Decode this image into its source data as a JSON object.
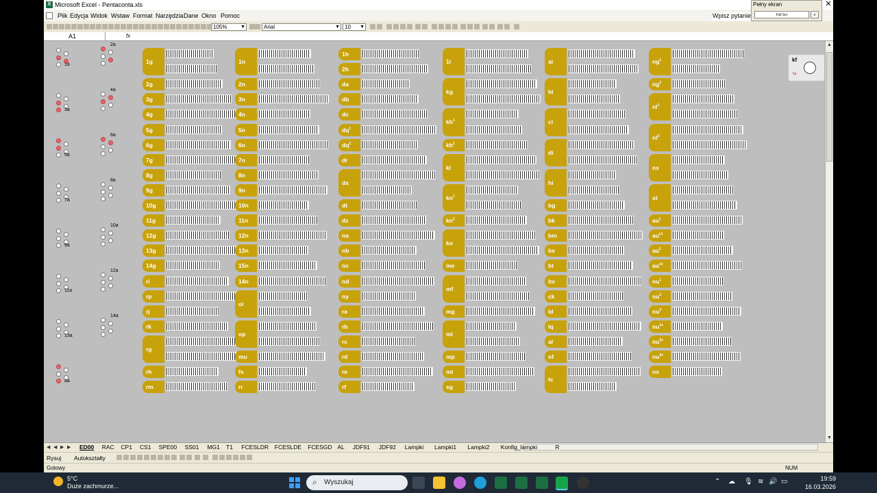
{
  "window": {
    "title": "Microsoft Excel - Pentaconta.xls",
    "help_placeholder": "Wpisz pytanie"
  },
  "menu": [
    "Plik",
    "Edycja",
    "Widok",
    "Wstaw",
    "Format",
    "Narzędzia",
    "Dane",
    "Okno",
    "Pomoc"
  ],
  "toolbar": {
    "zoom": "105%",
    "font": "Arial",
    "font_size": "10"
  },
  "formula_bar": {
    "name_box": "A1",
    "fx": "fx"
  },
  "fullscreen": {
    "title": "Pełny ekran",
    "button": "Full Scr",
    "close": "x"
  },
  "side_panel": {
    "label": "kf",
    "sub": "fig"
  },
  "dot_groups": [
    {
      "label": "1a",
      "red": [
        2,
        3
      ]
    },
    {
      "label": "2a",
      "red": [
        0,
        3
      ]
    },
    {
      "label": "3a",
      "red": [
        2,
        4
      ]
    },
    {
      "label": "4a",
      "red": [
        1,
        2
      ]
    },
    {
      "label": "5a",
      "red": [
        0,
        2
      ]
    },
    {
      "label": "6a",
      "red": [
        0,
        1
      ]
    },
    {
      "label": "7a",
      "red": []
    },
    {
      "label": "8a",
      "red": []
    },
    {
      "label": "9a",
      "red": []
    },
    {
      "label": "10a",
      "red": []
    },
    {
      "label": "11a",
      "red": []
    },
    {
      "label": "12a",
      "red": []
    },
    {
      "label": "13a",
      "red": []
    },
    {
      "label": "14a",
      "red": []
    },
    {
      "label": "aa",
      "red": [
        0,
        4
      ]
    }
  ],
  "columns": [
    {
      "rows": [
        {
          "label": "1g",
          "h": 2
        },
        {
          "label": "2g"
        },
        {
          "label": "3g"
        },
        {
          "label": "4g"
        },
        {
          "label": "5g"
        },
        {
          "label": "6g"
        },
        {
          "label": "7g"
        },
        {
          "label": "8g"
        },
        {
          "label": "9g"
        },
        {
          "label": "10g"
        },
        {
          "label": "11g"
        },
        {
          "label": "12g"
        },
        {
          "label": "13g"
        },
        {
          "label": "14g"
        },
        {
          "label": "ri"
        },
        {
          "label": "rp"
        },
        {
          "label": "rj"
        },
        {
          "label": "rk"
        },
        {
          "label": "rg",
          "h": 2
        },
        {
          "label": "rh"
        },
        {
          "label": "rm"
        }
      ]
    },
    {
      "rows": [
        {
          "label": "1n",
          "h": 2
        },
        {
          "label": "2n"
        },
        {
          "label": "3n"
        },
        {
          "label": "4n"
        },
        {
          "label": "5n"
        },
        {
          "label": "6n"
        },
        {
          "label": "7n"
        },
        {
          "label": "8n"
        },
        {
          "label": "9n"
        },
        {
          "label": "10n"
        },
        {
          "label": "11n"
        },
        {
          "label": "12n"
        },
        {
          "label": "13n"
        },
        {
          "label": "15n"
        },
        {
          "label": "14n"
        },
        {
          "label": "oi",
          "h": 2
        },
        {
          "label": "op",
          "h": 2
        },
        {
          "label": "mu"
        },
        {
          "label": "fs"
        },
        {
          "label": "rr"
        }
      ]
    },
    {
      "rows": [
        {
          "label": "1h"
        },
        {
          "label": "2h"
        },
        {
          "label": "da"
        },
        {
          "label": "db"
        },
        {
          "label": "dc"
        },
        {
          "label": "dq",
          "sup": "1"
        },
        {
          "label": "dq",
          "sup": "2"
        },
        {
          "label": "dr"
        },
        {
          "label": "ds",
          "h": 2
        },
        {
          "label": "dt"
        },
        {
          "label": "dz"
        },
        {
          "label": "na"
        },
        {
          "label": "nb"
        },
        {
          "label": "nc"
        },
        {
          "label": "nd"
        },
        {
          "label": "ny"
        },
        {
          "label": "ra"
        },
        {
          "label": "rb"
        },
        {
          "label": "rc"
        },
        {
          "label": "rd"
        },
        {
          "label": "re"
        },
        {
          "label": "rf"
        }
      ]
    },
    {
      "rows": [
        {
          "label": "1l",
          "h": 2
        },
        {
          "label": "kg",
          "h": 2
        },
        {
          "label": "kh",
          "sup": "1",
          "h": 2
        },
        {
          "label": "kh",
          "sup": "2"
        },
        {
          "label": "kl",
          "h": 2
        },
        {
          "label": "kn",
          "sup": "1",
          "h": 2
        },
        {
          "label": "kn",
          "sup": "2"
        },
        {
          "label": "ko",
          "h": 2
        },
        {
          "label": "me"
        },
        {
          "label": "mf",
          "h": 2
        },
        {
          "label": "mg"
        },
        {
          "label": "ml",
          "h": 2
        },
        {
          "label": "mp"
        },
        {
          "label": "mt"
        },
        {
          "label": "sg"
        }
      ]
    },
    {
      "rows": [
        {
          "label": "ai",
          "h": 2
        },
        {
          "label": "bi",
          "h": 2
        },
        {
          "label": "ci",
          "h": 2
        },
        {
          "label": "di",
          "h": 2
        },
        {
          "label": "hi",
          "h": 2
        },
        {
          "label": "bg"
        },
        {
          "label": "bk"
        },
        {
          "label": "bm"
        },
        {
          "label": "bs"
        },
        {
          "label": "bt"
        },
        {
          "label": "bv"
        },
        {
          "label": "ck"
        },
        {
          "label": "ld"
        },
        {
          "label": "lq"
        },
        {
          "label": "al"
        },
        {
          "label": "of"
        },
        {
          "label": "tc",
          "h": 2
        }
      ]
    },
    {
      "rows": [
        {
          "label": "ng",
          "sup": "1",
          "h": 2
        },
        {
          "label": "ng",
          "sup": "2"
        },
        {
          "label": "nl",
          "sup": "1",
          "h": 2
        },
        {
          "label": "nl",
          "sup": "2",
          "h": 2
        },
        {
          "label": "nx",
          "h": 2
        },
        {
          "label": "st",
          "h": 2
        },
        {
          "label": "au",
          "sup": "1"
        },
        {
          "label": "au",
          "sup": "x1"
        },
        {
          "label": "au",
          "sup": "2"
        },
        {
          "label": "au",
          "sup": "x2"
        },
        {
          "label": "nu",
          "sup": "1"
        },
        {
          "label": "nu",
          "sup": "2"
        },
        {
          "label": "nu",
          "sup": "3"
        },
        {
          "label": "nu",
          "sup": "1x"
        },
        {
          "label": "nu",
          "sup": "2x"
        },
        {
          "label": "nu",
          "sup": "3x"
        },
        {
          "label": "ns"
        }
      ]
    }
  ],
  "sheet_tabs": [
    "ED00",
    "RAC",
    "CP1",
    "CS1",
    "SPE00",
    "SS01",
    "MG1",
    "T1",
    "FCESLDR",
    "FCESLDE",
    "FCESGD",
    "AL",
    "JDF91",
    "JDF92",
    "Lampki",
    "Lampki1",
    "Lampki2",
    "Konfig_lampki",
    "R"
  ],
  "active_tab": "ED00",
  "drawbar": {
    "draw": "Rysuj",
    "autoshapes": "Autokształty"
  },
  "status": {
    "ready": "Gotowy",
    "num": "NUM"
  },
  "taskbar": {
    "temp": "5°C",
    "weather": "Duże zachmurze...",
    "search": "Wyszukaj",
    "time": "19:59",
    "date": "16.03.2026"
  }
}
